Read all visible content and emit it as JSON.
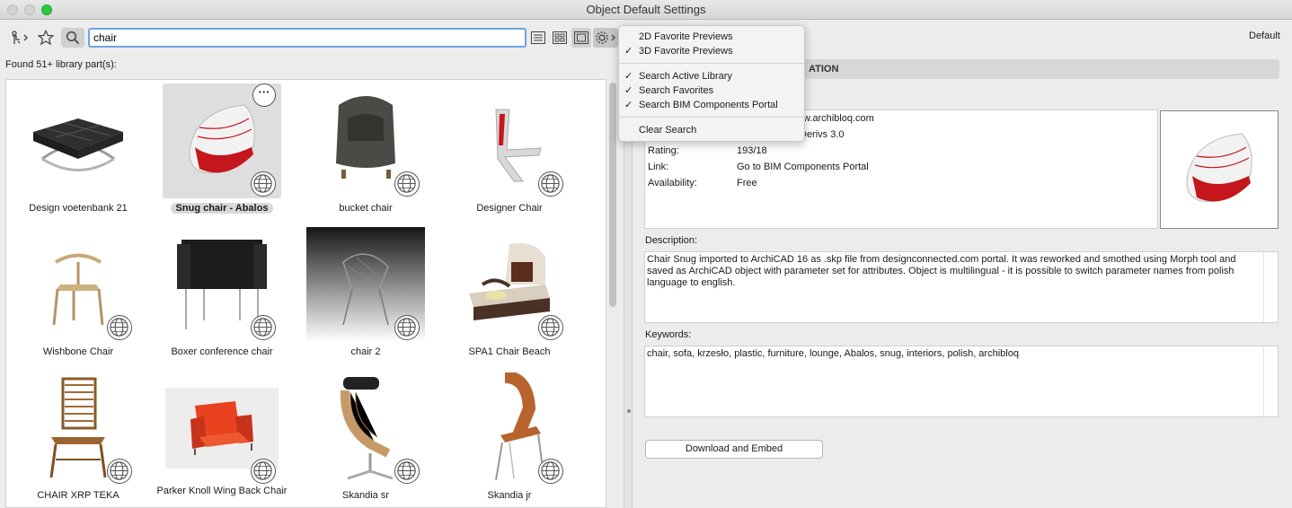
{
  "window": {
    "title": "Object Default Settings"
  },
  "toolbar": {
    "search_value": "chair",
    "icons": [
      "browse-tree-icon",
      "star-icon",
      "search-icon",
      "list-view-icon",
      "grid-view-icon",
      "preview-view-icon",
      "gear-icon"
    ]
  },
  "results": {
    "found_label": "Found 51+ library part(s):"
  },
  "items": [
    {
      "label": "Design voetenbank 21"
    },
    {
      "label": "Snug chair - Abalos",
      "selected": true
    },
    {
      "label": "bucket chair"
    },
    {
      "label": "Designer Chair"
    },
    {
      "label": "Wishbone Chair"
    },
    {
      "label": "Boxer conference chair"
    },
    {
      "label": "chair 2"
    },
    {
      "label": "SPA1 Chair Beach"
    },
    {
      "label": "CHAIR XRP TEKA"
    },
    {
      "label": "Parker Knoll Wing Back Chair"
    },
    {
      "label": "Skandia sr"
    },
    {
      "label": "Skandia jr"
    }
  ],
  "menu": {
    "items": [
      {
        "label": "2D Favorite Previews",
        "checked": false
      },
      {
        "label": "3D Favorite Previews",
        "checked": true
      },
      {
        "label": "Search Active Library",
        "checked": true
      },
      {
        "label": "Search Favorites",
        "checked": true
      },
      {
        "label": "Search BIM Components Portal",
        "checked": true
      },
      {
        "label": "Clear Search",
        "checked": false
      }
    ],
    "check_glyph": "✓"
  },
  "details": {
    "default_label": "Default",
    "section_title": "ATION",
    "info": {
      "source_partial": "ww.archibloq.com",
      "license_partial": "Derivs 3.0",
      "rating_label": "Rating:",
      "rating_value": "193/18",
      "link_label": "Link:",
      "link_value": "Go to BIM Components Portal",
      "availability_label": "Availability:",
      "availability_value": "Free"
    },
    "description_label": "Description:",
    "description_text": "Chair Snug imported to ArchiCAD 16 as .skp file from designconnected.com portal. It was reworked and smothed using Morph tool and saved as ArchiCAD object with parameter set for attributes. Object is multilingual - it is possible to switch parameter names from polish language to english.",
    "keywords_label": "Keywords:",
    "keywords_text": "chair, sofa, krzesło, plastic, furniture, lounge, Abalos, snug, interiors, polish, archibloq",
    "download_button": "Download and Embed"
  },
  "colors": {
    "accent": "#6ea3e6",
    "green_traffic": "#2dc840",
    "chair_red": "#c4161c"
  }
}
